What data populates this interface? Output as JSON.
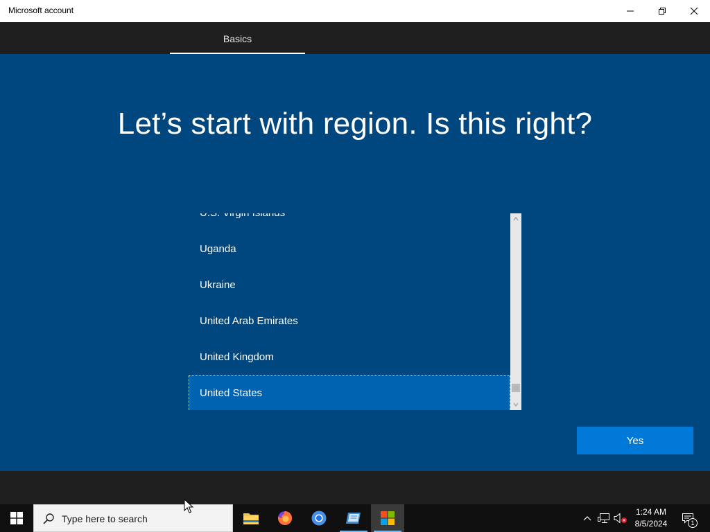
{
  "window": {
    "title": "Microsoft account",
    "controls": [
      "minimize-icon",
      "restore-icon",
      "close-icon"
    ]
  },
  "nav": {
    "tabs": [
      {
        "label": "Basics",
        "active": true
      }
    ]
  },
  "main": {
    "heading": "Let’s start with region. Is this right?",
    "regions": [
      "U.S. Virgin Islands",
      "Uganda",
      "Ukraine",
      "United Arab Emirates",
      "United Kingdom",
      "United States"
    ],
    "selected_region": "United States",
    "yes_label": "Yes"
  },
  "taskbar": {
    "search_placeholder": "Type here to search",
    "apps": [
      {
        "name": "file-explorer-icon",
        "running": false
      },
      {
        "name": "firefox-icon",
        "running": false
      },
      {
        "name": "chromium-icon",
        "running": false
      },
      {
        "name": "notes-app-icon",
        "running": true
      },
      {
        "name": "microsoft-store-icon",
        "running": true,
        "active": true
      }
    ],
    "clock": {
      "time": "1:24 AM",
      "date": "8/5/2024"
    },
    "notification_count": "1"
  },
  "colors": {
    "background": "#00467f",
    "nav_bar": "#1f1f1f",
    "selected_item": "#0063b1",
    "accent_button": "#0078d7",
    "taskbar": "#101010"
  }
}
